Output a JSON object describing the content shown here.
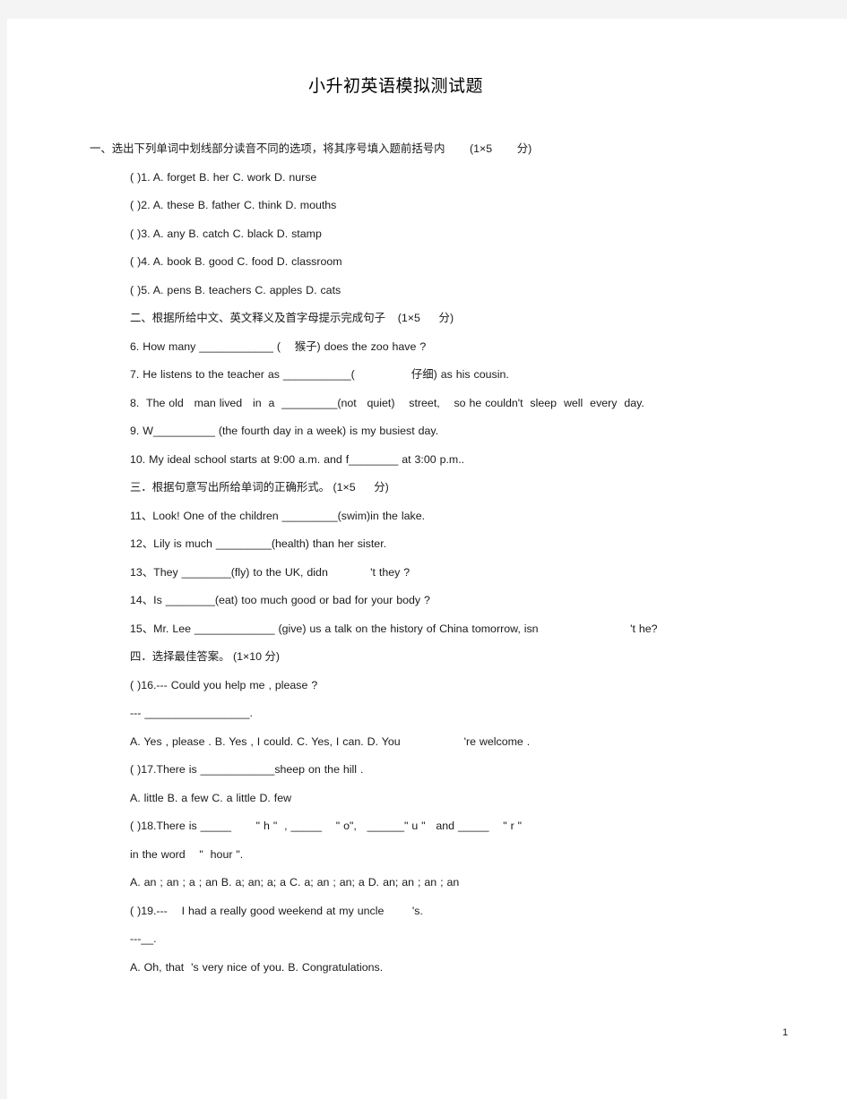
{
  "document": {
    "title": "小升初英语模拟测试题",
    "page_number": "1"
  },
  "sections": [
    {
      "heading": "一、选出下列单词中划线部分读音不同的选项，将其序号填入题前括号内        (1×5        分)",
      "lines": [
        "( )1. A. forget B. her C. work D. nurse",
        "( )2. A. these B. father C. think D. mouths",
        "( )3. A. any B. catch C. black D. stamp",
        "( )4. A. book B. good C. food D. classroom",
        "( )5. A. pens B. teachers C. apples D. cats"
      ]
    },
    {
      "heading": "二、根据所给中文、英文释义及首字母提示完成句子    (1×5      分)",
      "lines": [
        "6. How many ____________ (    猴子) does the zoo have ?",
        "7. He listens to the teacher as ___________(                仔细) as his cousin.",
        "8.  The old   man lived   in  a  _________(not   quiet)    street,    so he couldn't  sleep  well  every  day.",
        "9. W__________ (the fourth day in a week) is my busiest day.",
        "10. My ideal school starts at 9:00 a.m. and f________ at 3:00 p.m.."
      ]
    },
    {
      "heading": "三．根据句意写出所给单词的正确形式。 (1×5      分)",
      "lines": [
        "11、Look! One of the children _________(swim)in the lake.",
        "12、Lily is much _________(health) than her sister.",
        "13、They ________(fly) to the UK, didn            't they ?",
        "14、Is ________(eat) too much good or bad for your body ?",
        "15、Mr. Lee _____________ (give) us a talk on the history of China tomorrow, isn                          't he?"
      ]
    },
    {
      "heading": "四．选择最佳答案。 (1×10 分)",
      "lines": [
        "( )16.--- Could you help me , please ?",
        "--- _________________.",
        "A. Yes , please . B. Yes , I could. C. Yes, I can. D. You                  're welcome .",
        "( )17.There is ____________sheep on the hill .",
        "A. little B. a few C. a little D. few",
        "( )18.There is _____       \" h \"  , _____    \" o\",   ______\" u \"   and _____    \" r \"",
        "in the word    \"  hour \".",
        "A. an ; an ; a ; an B. a; an; a; a C. a; an ; an; a D. an; an ; an ; an",
        "( )19.---    I had a really good weekend at my uncle        's.",
        "---__.",
        "A. Oh, that  's very nice of you. B. Congratulations."
      ]
    }
  ]
}
